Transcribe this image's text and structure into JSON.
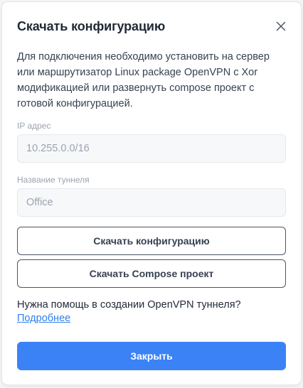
{
  "dialog": {
    "title": "Скачать конфигурацию",
    "close_icon": "close-icon",
    "description": "Для подключения необходимо установить на сервер или маршрутизатор Linux package OpenVPN с Xor модификацией или развернуть compose проект с готовой конфигурацией."
  },
  "fields": {
    "ip": {
      "label": "IP адрес",
      "placeholder": "10.255.0.0/16",
      "value": ""
    },
    "tunnel": {
      "label": "Название туннеля",
      "placeholder": "Office",
      "value": ""
    }
  },
  "buttons": {
    "download_config": "Скачать конфигурацию",
    "download_compose": "Скачать Compose проект",
    "close": "Закрыть"
  },
  "help": {
    "text": "Нужна помощь в создании OpenVPN туннеля?",
    "link": "Подробнее"
  },
  "colors": {
    "primary": "#3b82f6",
    "link": "#2f80ed",
    "title": "#1f2937"
  }
}
